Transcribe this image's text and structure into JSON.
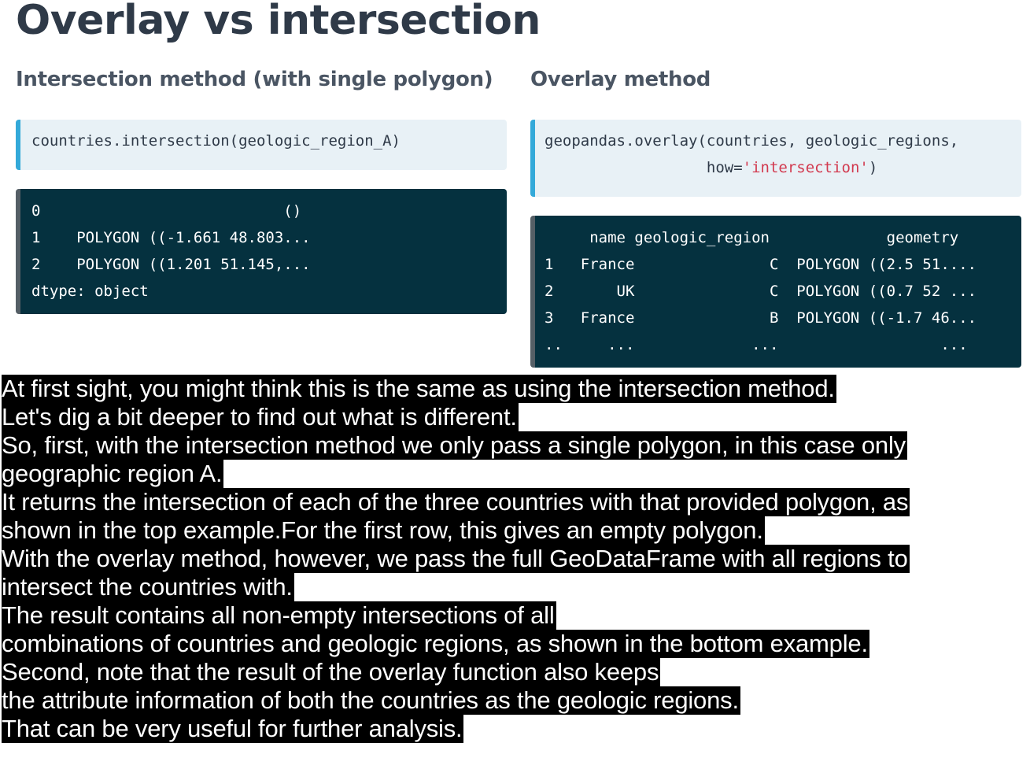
{
  "slide": {
    "title": "Overlay vs intersection",
    "left_heading": "Intersection method (with single polygon)",
    "right_heading": "Overlay method"
  },
  "left_code": {
    "input": "countries.intersection(geologic_region_A)",
    "output_lines": [
      "0                           ()",
      "1    POLYGON ((-1.661 48.803...",
      "2    POLYGON ((1.201 51.145,...",
      "dtype: object"
    ]
  },
  "right_code": {
    "input_line1": "geopandas.overlay(countries, geologic_regions,",
    "input_line2_prefix": "                  how=",
    "input_line2_string": "'intersection'",
    "input_line2_suffix": ")",
    "output_lines": [
      "     name geologic_region             geometry",
      "1   France               C  POLYGON ((2.5 51....",
      "2       UK               C  POLYGON ((0.7 52 ...",
      "3   France               B  POLYGON ((-1.7 46...",
      "..     ...             ...                  ..."
    ]
  },
  "subtitles": [
    "At first sight, you might think this is the same as using the intersection method.",
    "Let's dig a bit deeper to find out what is different.",
    "So, first, with the intersection method we only pass a single polygon, in this case only",
    "geographic region A.",
    "It returns the intersection of each of the three countries with that provided polygon, as",
    "shown in the top example.For the first row, this gives an empty polygon.",
    "With the overlay method, however, we pass the full GeoDataFrame with all regions to",
    "intersect the countries with.",
    "The result contains all non-empty intersections of all",
    "combinations of countries and geologic regions, as shown in the bottom example.",
    "Second, note that the result of the overlay function also keeps",
    "the attribute information of both the countries as the geologic regions.",
    "That can be very useful for further analysis."
  ],
  "colors": {
    "title": "#2f3a48",
    "code_bg": "#e8f1f6",
    "code_accent": "#33a9d9",
    "output_bg": "#05313f",
    "string": "#d23a4f"
  }
}
